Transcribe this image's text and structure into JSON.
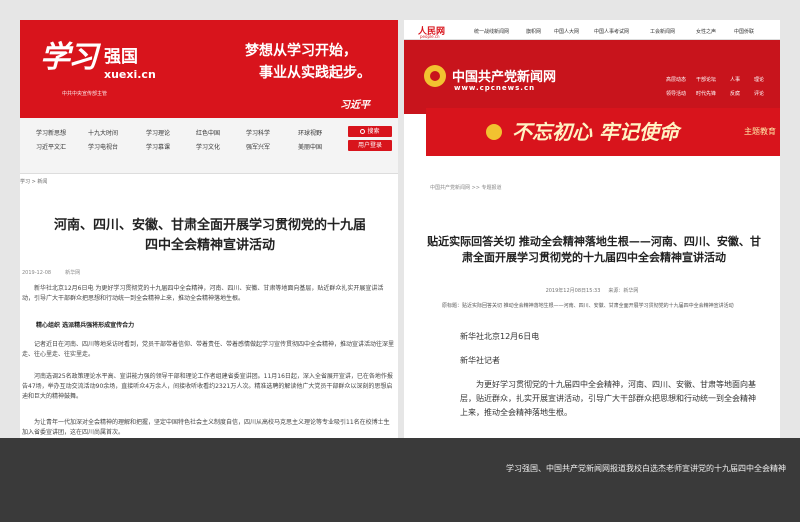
{
  "caption": "学习强国、中国共产党新闻网报道我校白选杰老师宣讲党的十九届四中全会精神",
  "xuexi": {
    "logo_mark": "学习",
    "logo_name": "强国",
    "domain": "xuexi.cn",
    "sub": "中共中央宣传部主管",
    "slogan_1": "梦想从学习开始，",
    "slogan_2": "事业从实践起步。",
    "signature": "习近平",
    "nav": {
      "row1": [
        "学习新思想",
        "十九大时间",
        "学习理论",
        "红色中国",
        "学习科学",
        "环球视野"
      ],
      "row2": [
        "习近平文汇",
        "学习电视台",
        "学习慕课",
        "学习文化",
        "强军兴军",
        "美丽中国"
      ]
    },
    "search_label": "搜索",
    "user_label": "用户登录",
    "breadcrumb": "学习 > 新闻",
    "title": "河南、四川、安徽、甘肃全面开展学习贯彻党的十九届四中全会精神宣讲活动",
    "date": "2019-12-08",
    "source": "新华网",
    "para_1": "新华社北京12月6日电 为更好学习贯彻党的十九届四中全会精神，河南、四川、安徽、甘肃等地面向基层，贴近群众扎实开展宣讲活动，引导广大干部群众把思想和行动统一到全会精神上来，推动全会精神落地生根。",
    "subheading": "精心组织 选派精兵强将形成宣传合力",
    "para_2": "记者近日在河南、四川等地采访时看到，党员干部带着信仰、带着责任、带着感情做起学习宣传贯彻四中全会精神，推动宣讲活动往深里走、往心里走、往实里走。",
    "para_3": "河南选调25名政策理论水平高、宣讲能力强的领导干部和理论工作者组建省委宣讲团。11月16日起，深入全省展开宣讲，已在各地作报告47场，举办互动交流活动90余场，直接听众4万余人，间接收听收看约2321万人次。精准选聘的解读他广大党员干部群众以深刻的思想启迪和巨大的精神鼓舞。",
    "para_4": "为让青年一代加深对全会精神的理解和把握，坚定中国特色社会主义制度自信，四川从高校马克思主义理论等专业吸引11名在校博士生加入省委宣讲团，这在四川尚属首次。"
  },
  "cpc": {
    "pd_logo": "人民网",
    "pd_logo_sub": "people.cn",
    "pd_links": [
      "统一战线新闻网",
      "旗帜网",
      "中国人大网",
      "中国人事考试网",
      "工会新闻网",
      "女性之声",
      "中国侨联"
    ],
    "header_title": "中国共产党新闻网",
    "header_domain": "www.cpcnews.cn",
    "nav": {
      "row1": [
        "高层动态",
        "干部论坛",
        "人事",
        "理论"
      ],
      "row2": [
        "领导活动",
        "时代先锋",
        "反腐",
        "评论"
      ]
    },
    "banner_text": "不忘初心 牢记使命",
    "banner_sub": "主题教育",
    "breadcrumb": "中国共产党新闻网 >> 专题报道",
    "title": "贴近实际回答关切 推动全会精神落地生根——河南、四川、安徽、甘肃全面开展学习贯彻党的十九届四中全会精神宣讲活动",
    "date": "2019年12月08日15:33",
    "source": "来源：新华网",
    "summary": "原标题：贴近实际回答关切 推动全会精神落地生根——河南、四川、安徽、甘肃全面开展学习贯彻党的十九届四中全会精神宣讲活动",
    "para_1": "新华社北京12月6日电",
    "para_2": "新华社记者",
    "para_3": "为更好学习贯彻党的十九届四中全会精神，河南、四川、安徽、甘肃等地面向基层，贴近群众，扎实开展宣讲活动，引导广大干部群众把思想和行动统一到全会精神上来，推动全会精神落地生根。"
  },
  "colors": {
    "brand_red": "#d8141c",
    "dark_bar": "#3a3a3a",
    "gold": "#f2c230"
  }
}
